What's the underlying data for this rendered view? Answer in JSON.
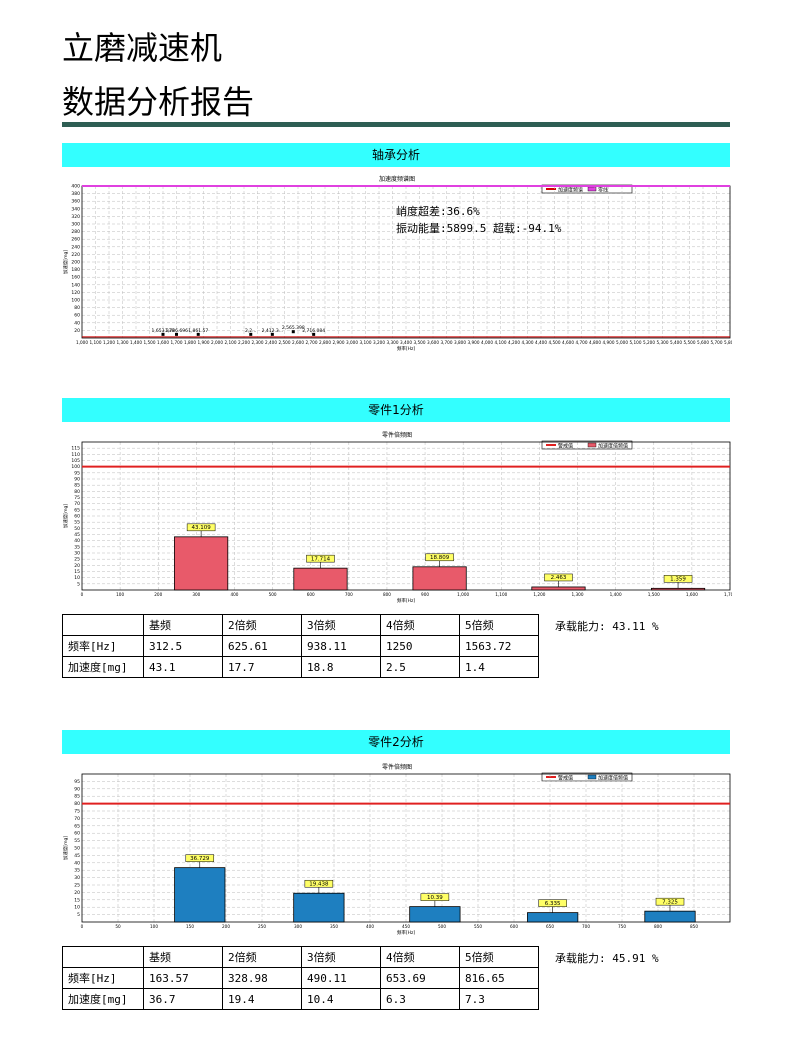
{
  "title_line1": "立磨减速机",
  "title_line2": "数据分析报告",
  "sections": [
    {
      "banner": "轴承分析"
    },
    {
      "banner": "零件1分析"
    },
    {
      "banner": "零件2分析"
    }
  ],
  "bearing": {
    "chart_title": "加速度频谱图",
    "legend": [
      "加速度频谱",
      "零线"
    ],
    "ylabel": "加速度[mg]",
    "xlabel": "频率[Hz]",
    "annotation1": "峭度超差:36.6%",
    "annotation2": "振动能量:5899.5    超载:-94.1%",
    "colors": {
      "threshold": "#e040e0",
      "spectrum": "#d00000"
    },
    "chart_data": {
      "type": "line",
      "xlim": [
        1000,
        5800
      ],
      "ylim": [
        0,
        400
      ],
      "y_ticks": [
        20,
        40,
        60,
        80,
        100,
        120,
        140,
        160,
        180,
        200,
        220,
        240,
        260,
        280,
        300,
        320,
        340,
        360,
        380,
        400
      ],
      "x_ticks": [
        1000,
        1100,
        1200,
        1300,
        1400,
        1500,
        1600,
        1700,
        1800,
        1900,
        2000,
        2100,
        2200,
        2300,
        2400,
        2500,
        2600,
        2700,
        2800,
        2900,
        3000,
        3100,
        3200,
        3300,
        3400,
        3500,
        3600,
        3700,
        3800,
        3900,
        4000,
        4100,
        4200,
        4300,
        4400,
        4500,
        4600,
        4700,
        4800,
        4900,
        5000,
        5100,
        5200,
        5300,
        5400,
        5500,
        5600,
        5700,
        5800
      ],
      "threshold": 400,
      "peak_labels": [
        {
          "x": 1600,
          "y": 3,
          "text": "1,653.338"
        },
        {
          "x": 1700,
          "y": 3,
          "text": "1,736.696"
        },
        {
          "x": 1861,
          "y": 3,
          "text": "1,861.57"
        },
        {
          "x": 2250,
          "y": 3,
          "text": "2,2..."
        },
        {
          "x": 2410,
          "y": 3,
          "text": "2,412.3..."
        },
        {
          "x": 2565,
          "y": 10,
          "text": "2,565.398"
        },
        {
          "x": 2716,
          "y": 3,
          "text": "2,716.084"
        }
      ]
    }
  },
  "part1": {
    "chart_title": "零件倍频图",
    "legend": [
      "警戒值",
      "加速度倍频值"
    ],
    "ylabel": "加速度[mg]",
    "xlabel": "频率[Hz]",
    "colors": {
      "bar": "#e85a6a",
      "threshold": "#e02020"
    },
    "chart_data": {
      "type": "bar",
      "xlim": [
        0,
        1700
      ],
      "ylim": [
        0,
        120
      ],
      "x_ticks": [
        0,
        100,
        200,
        300,
        400,
        500,
        600,
        700,
        800,
        900,
        1000,
        1100,
        1200,
        1300,
        1400,
        1500,
        1600,
        1700
      ],
      "y_ticks": [
        5,
        10,
        15,
        20,
        25,
        30,
        35,
        40,
        45,
        50,
        55,
        60,
        65,
        70,
        75,
        80,
        85,
        90,
        95,
        100,
        105,
        110,
        115
      ],
      "x": [
        312.5,
        625.61,
        938.11,
        1250,
        1563.72
      ],
      "values": [
        43.109,
        17.714,
        18.809,
        2.463,
        1.359
      ],
      "threshold": 100,
      "bar_width": 140
    },
    "table": {
      "header": [
        "",
        "基频",
        "2倍频",
        "3倍频",
        "4倍频",
        "5倍频"
      ],
      "rows": [
        [
          "频率[Hz]",
          "312.5",
          "625.61",
          "938.11",
          "1250",
          "1563.72"
        ],
        [
          "加速度[mg]",
          "43.1",
          "17.7",
          "18.8",
          "2.5",
          "1.4"
        ]
      ]
    },
    "capacity": "承载能力: 43.11 %"
  },
  "part2": {
    "chart_title": "零件倍频图",
    "legend": [
      "警戒值",
      "加速度倍频值"
    ],
    "ylabel": "加速度[mg]",
    "xlabel": "频率[Hz]",
    "colors": {
      "bar": "#1e7fc0",
      "threshold": "#e02020"
    },
    "chart_data": {
      "type": "bar",
      "xlim": [
        0,
        900
      ],
      "ylim": [
        0,
        100
      ],
      "x_ticks": [
        0,
        50,
        100,
        150,
        200,
        250,
        300,
        350,
        400,
        450,
        500,
        550,
        600,
        650,
        700,
        750,
        800,
        850
      ],
      "y_ticks": [
        5,
        10,
        15,
        20,
        25,
        30,
        35,
        40,
        45,
        50,
        55,
        60,
        65,
        70,
        75,
        80,
        85,
        90,
        95
      ],
      "x": [
        163.57,
        328.98,
        490.11,
        653.69,
        816.65
      ],
      "values": [
        36.729,
        19.438,
        10.39,
        6.335,
        7.325
      ],
      "threshold": 80,
      "bar_width": 70
    },
    "table": {
      "header": [
        "",
        "基频",
        "2倍频",
        "3倍频",
        "4倍频",
        "5倍频"
      ],
      "rows": [
        [
          "频率[Hz]",
          "163.57",
          "328.98",
          "490.11",
          "653.69",
          "816.65"
        ],
        [
          "加速度[mg]",
          "36.7",
          "19.4",
          "10.4",
          "6.3",
          "7.3"
        ]
      ]
    },
    "capacity": "承载能力: 45.91 %"
  }
}
